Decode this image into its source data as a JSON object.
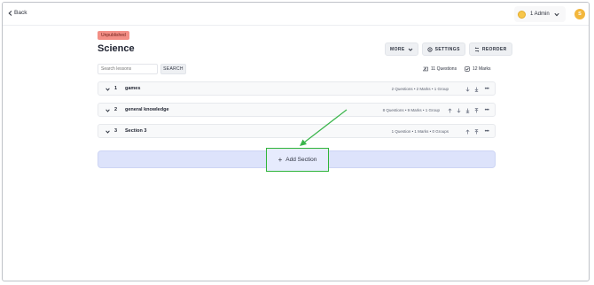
{
  "header": {
    "back_label": "Back",
    "user_label": "1 Admin",
    "avatar_initial": "S"
  },
  "course": {
    "status_badge": "Unpublished",
    "title": "Science"
  },
  "toolbar": {
    "more_label": "MORE",
    "settings_label": "SETTINGS",
    "reorder_label": "REORDER"
  },
  "search": {
    "placeholder": "Search lessons",
    "button_label": "SEARCH"
  },
  "stats": {
    "questions": "11 Questions",
    "marks": "12 Marks"
  },
  "sections": [
    {
      "number": "1",
      "name": "games",
      "meta": "2 Questions  •  2 Marks  •  1 Group"
    },
    {
      "number": "2",
      "name": "general knowledge",
      "meta": "8 Questions  •  9 Marks  •  1 Group"
    },
    {
      "number": "3",
      "name": "Section 3",
      "meta": "1 Question  •  1 Marks  •  0 Groups"
    }
  ],
  "add_section": {
    "label": "Add Section"
  },
  "colors": {
    "badge": "#f38f86",
    "add_bar": "#dde3fb",
    "highlight": "#2fb53a",
    "avatar": "#f3b73c"
  }
}
